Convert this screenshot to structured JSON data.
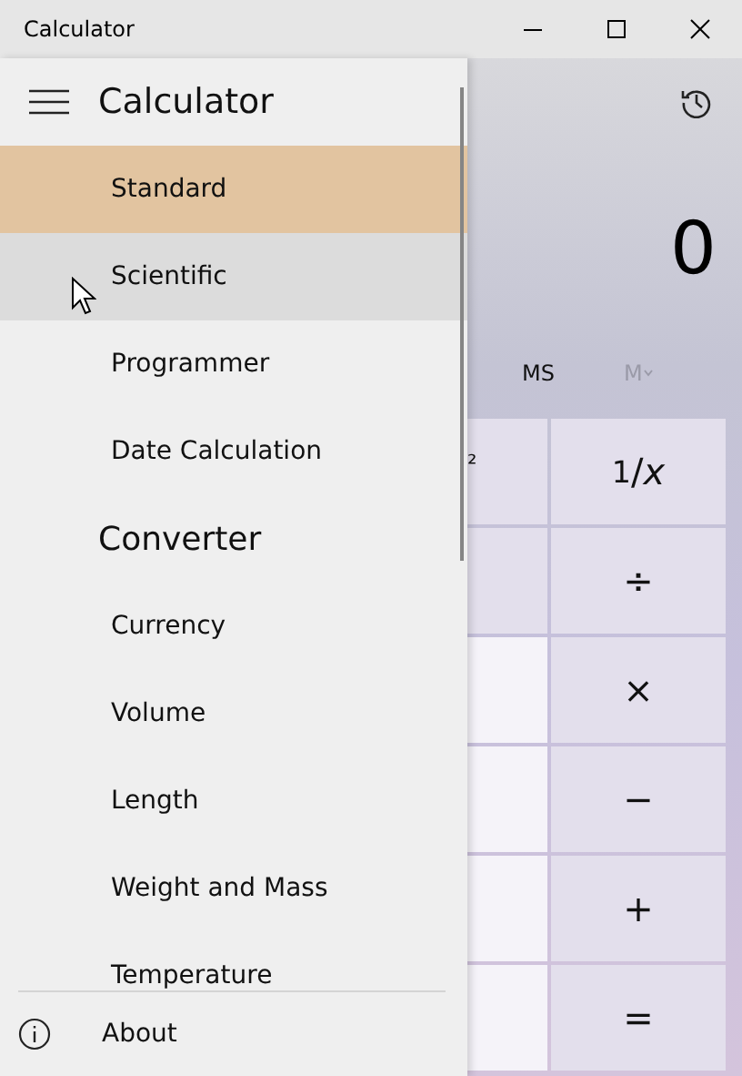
{
  "window": {
    "title": "Calculator"
  },
  "nav": {
    "title": "Calculator",
    "sections": [
      {
        "items": [
          {
            "label": "Standard",
            "selected": true,
            "hovered": false
          },
          {
            "label": "Scientific",
            "selected": false,
            "hovered": true
          },
          {
            "label": "Programmer",
            "selected": false,
            "hovered": false
          },
          {
            "label": "Date Calculation",
            "selected": false,
            "hovered": false
          }
        ]
      },
      {
        "heading": "Converter",
        "items": [
          {
            "label": "Currency",
            "selected": false,
            "hovered": false
          },
          {
            "label": "Volume",
            "selected": false,
            "hovered": false
          },
          {
            "label": "Length",
            "selected": false,
            "hovered": false
          },
          {
            "label": "Weight and Mass",
            "selected": false,
            "hovered": false
          },
          {
            "label": "Temperature",
            "selected": false,
            "hovered": false
          }
        ]
      }
    ],
    "footer": {
      "label": "About"
    }
  },
  "calculator": {
    "display": "0",
    "memory": [
      {
        "label": "MS",
        "disabled": false
      },
      {
        "label": "M",
        "disabled": true
      }
    ],
    "keys": [
      [
        {
          "kind": "function",
          "label": "²"
        },
        {
          "kind": "function",
          "label": "$^{1}$/*x*"
        }
      ],
      [
        {
          "kind": "function"
        },
        {
          "kind": "operator",
          "label": "÷"
        }
      ],
      [
        {
          "kind": "digit"
        },
        {
          "kind": "operator",
          "label": "×"
        }
      ],
      [
        {
          "kind": "digit"
        },
        {
          "kind": "operator",
          "label": "−"
        }
      ],
      [
        {
          "kind": "digit"
        },
        {
          "kind": "operator",
          "label": "+"
        }
      ],
      [
        {
          "kind": "digit"
        },
        {
          "kind": "operator",
          "label": "="
        }
      ]
    ]
  }
}
